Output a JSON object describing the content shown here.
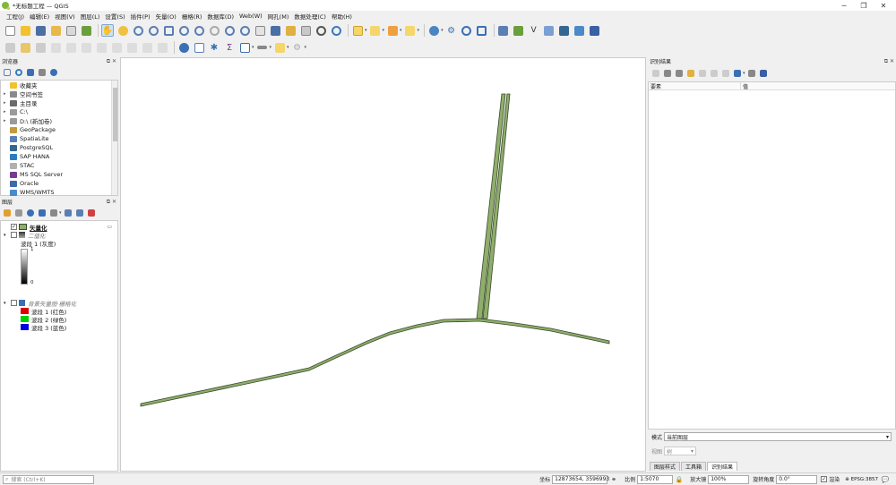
{
  "window": {
    "title": "*无标题工程 — QGIS",
    "minimize": "─",
    "restore": "❐",
    "close": "✕"
  },
  "menu": [
    "工程(J)",
    "编辑(E)",
    "视图(V)",
    "图层(L)",
    "设置(S)",
    "插件(P)",
    "矢量(O)",
    "栅格(R)",
    "数据库(D)",
    "Web(W)",
    "网孔(M)",
    "数据处理(C)",
    "帮助(H)"
  ],
  "browser": {
    "title": "浏览器",
    "items": [
      {
        "label": "收藏夹",
        "color": "#f2c12e",
        "arrow": ""
      },
      {
        "label": "空间书签",
        "color": "#8a8a8a",
        "arrow": "▸"
      },
      {
        "label": "主目录",
        "color": "#6a6a6a",
        "arrow": "▸"
      },
      {
        "label": "C:\\",
        "color": "#9a9a9a",
        "arrow": "▸"
      },
      {
        "label": "D:\\ (新加卷)",
        "color": "#9a9a9a",
        "arrow": "▸"
      },
      {
        "label": "GeoPackage",
        "color": "#c59a3a",
        "arrow": ""
      },
      {
        "label": "SpatiaLite",
        "color": "#5a7fb5",
        "arrow": ""
      },
      {
        "label": "PostgreSQL",
        "color": "#336791",
        "arrow": ""
      },
      {
        "label": "SAP HANA",
        "color": "#2a7bc4",
        "arrow": ""
      },
      {
        "label": "STAC",
        "color": "#b0b0b0",
        "arrow": ""
      },
      {
        "label": "MS SQL Server",
        "color": "#7a3b8f",
        "arrow": ""
      },
      {
        "label": "Oracle",
        "color": "#3d6aa8",
        "arrow": ""
      },
      {
        "label": "WMS/WMTS",
        "color": "#4a8ac9",
        "arrow": ""
      }
    ]
  },
  "layers": {
    "title": "图层",
    "vector_layer": "矢量化",
    "raster1": {
      "name": "二值化",
      "band": "波段 1 (灰度)",
      "max": "1",
      "min": "0"
    },
    "raster2": {
      "name": "背景矢量图·栅格化",
      "bands": [
        {
          "label": "波段 1 (红色)",
          "color": "#e00000"
        },
        {
          "label": "波段 2 (绿色)",
          "color": "#00d000"
        },
        {
          "label": "波段 3 (蓝色)",
          "color": "#0000e0"
        }
      ]
    }
  },
  "identify": {
    "title": "识别结果",
    "col_feature": "要素",
    "col_value": "值",
    "mode_label": "模式",
    "mode_value": "当前图层",
    "view_label": "视图",
    "view_value": "树",
    "tabs": [
      "图层样式",
      "工具箱",
      "识别结果"
    ]
  },
  "status": {
    "search_placeholder": "搜索 (Ctrl+K)",
    "coord_label": "坐标",
    "coord_value": "12873654, 3596993",
    "scale_label": "比例",
    "scale_value": "1:5070",
    "magnifier_label": "放大镜",
    "magnifier_value": "100%",
    "rotation_label": "旋转角度",
    "rotation_value": "0.0°",
    "render_label": "渲染",
    "crs": "EPSG:3857"
  },
  "colors": {
    "feature_fill": "#8fae6b",
    "feature_stroke": "#3a4a2c"
  }
}
